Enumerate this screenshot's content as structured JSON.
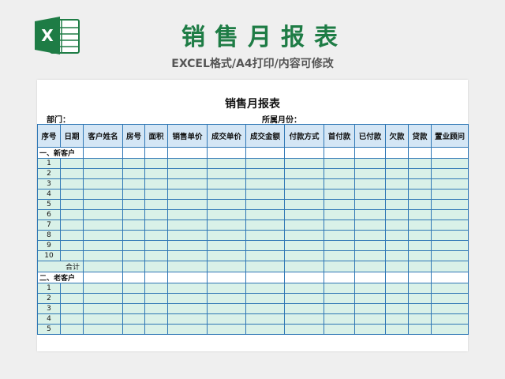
{
  "banner": {
    "title": "销售月报表",
    "subtitle": "EXCEL格式/A4打印/内容可修改",
    "logo_icon": "excel-logo-icon",
    "brand_color": "#1e7c45"
  },
  "sheet": {
    "title": "销售月报表",
    "department_label": "部门：",
    "month_label": "所属月份："
  },
  "table": {
    "columns": [
      "序号",
      "日期",
      "客户姓名",
      "房号",
      "面积",
      "销售单价",
      "成交单价",
      "成交金额",
      "付款方式",
      "首付款",
      "已付款",
      "欠款",
      "贷款",
      "置业顾问"
    ],
    "section_new": "一、新客户",
    "new_rows": [
      "1",
      "2",
      "3",
      "4",
      "5",
      "6",
      "7",
      "8",
      "9",
      "10"
    ],
    "total_label": "合计",
    "section_old": "二、老客户",
    "old_rows": [
      "1",
      "2",
      "3",
      "4",
      "5"
    ],
    "header_color": "#d4e6f5",
    "row_color": "#d9f1e8",
    "border_color": "#2f77b5"
  }
}
